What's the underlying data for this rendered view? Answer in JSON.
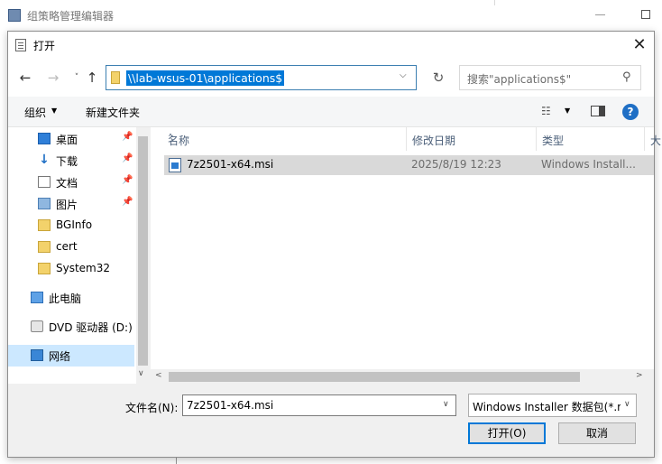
{
  "background_window": {
    "title": "组策略管理编辑器"
  },
  "dialog": {
    "title": "打开",
    "close_glyph": "✕"
  },
  "navigation": {
    "back_glyph": "←",
    "forward_glyph": "→",
    "recent_glyph": "˅",
    "up_glyph": "↑",
    "address": "\\\\lab-wsus-01\\applications$",
    "address_dropdown_glyph": "⌵",
    "refresh_glyph": "↻",
    "search_placeholder": "搜索\"applications$\"",
    "search_glyph": "⚲"
  },
  "toolbar": {
    "organize_label": "组织",
    "organize_caret": "▼",
    "new_folder_label": "新建文件夹",
    "view_glyph": "☷",
    "view_caret": "▼",
    "help_glyph": "?"
  },
  "sidebar": {
    "pin_glyph": "📌",
    "items": [
      {
        "label": "桌面",
        "icon": "desktop-icon",
        "pinned": true
      },
      {
        "label": "下载",
        "icon": "download-icon",
        "pinned": true
      },
      {
        "label": "文档",
        "icon": "document-icon",
        "pinned": true
      },
      {
        "label": "图片",
        "icon": "picture-icon",
        "pinned": true
      },
      {
        "label": "BGInfo",
        "icon": "folder-icon",
        "pinned": false
      },
      {
        "label": "cert",
        "icon": "folder-icon",
        "pinned": false
      },
      {
        "label": "System32",
        "icon": "folder-icon",
        "pinned": false
      },
      {
        "label": "此电脑",
        "icon": "computer-icon",
        "pinned": false
      },
      {
        "label": "DVD 驱动器 (D:)",
        "icon": "dvd-drive-icon",
        "pinned": false
      },
      {
        "label": "网络",
        "icon": "network-icon",
        "pinned": false,
        "selected": true
      }
    ],
    "scroll_down_glyph": "∨"
  },
  "file_list": {
    "columns": [
      "名称",
      "修改日期",
      "类型",
      "大"
    ],
    "sort_caret": "˄",
    "rows": [
      {
        "name": "7z2501-x64.msi",
        "modified": "2025/8/19 12:23",
        "type": "Windows Install...",
        "icon": "msi-installer-icon"
      }
    ],
    "scroll_left_glyph": "<",
    "scroll_right_glyph": ">"
  },
  "footer": {
    "filename_label": "文件名(N):",
    "filename_value": "7z2501-x64.msi",
    "filename_dropdown_glyph": "∨",
    "filetype_value": "Windows Installer 数据包(*.m",
    "filetype_dropdown_glyph": "∨",
    "open_label": "打开(O)",
    "cancel_label": "取消"
  },
  "colors": {
    "selection_blue": "#0078d7",
    "nav_selected": "#cce8ff",
    "row_selected": "#d9d9d9"
  }
}
